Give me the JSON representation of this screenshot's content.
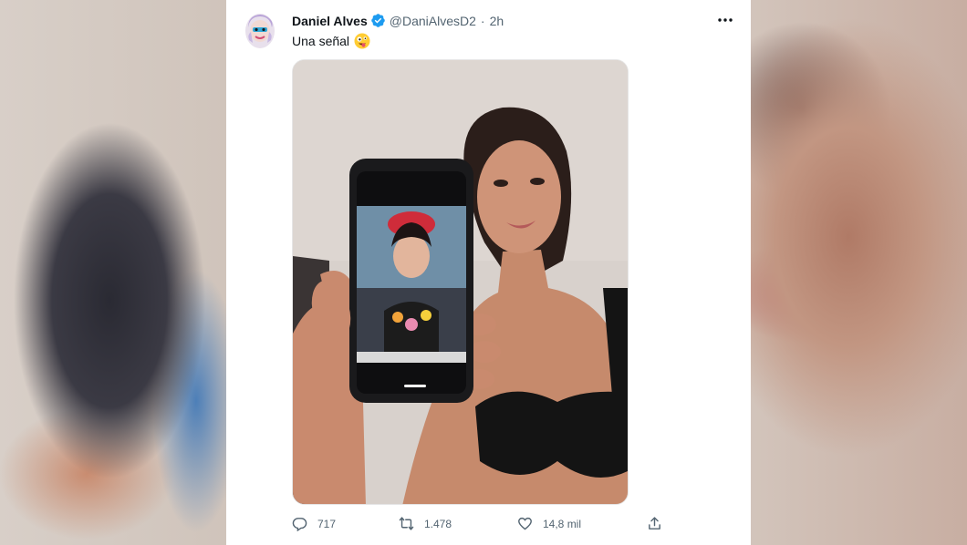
{
  "tweet": {
    "author_name": "Daniel Alves",
    "handle": "@DaniAlvesD2",
    "separator": "·",
    "time": "2h",
    "text": "Una señal",
    "emoji": "zany-face-emoji",
    "verified": true
  },
  "actions": {
    "reply_count": "717",
    "retweet_count": "1.478",
    "like_count": "14,8 mil"
  },
  "icons": {
    "more": "more-horizontal-icon",
    "reply": "reply-icon",
    "retweet": "retweet-icon",
    "like": "heart-icon",
    "share": "share-icon",
    "verified": "verified-badge-icon"
  },
  "colors": {
    "verified_blue": "#1d9bf0",
    "text_primary": "#0f1419",
    "text_secondary": "#536471"
  }
}
